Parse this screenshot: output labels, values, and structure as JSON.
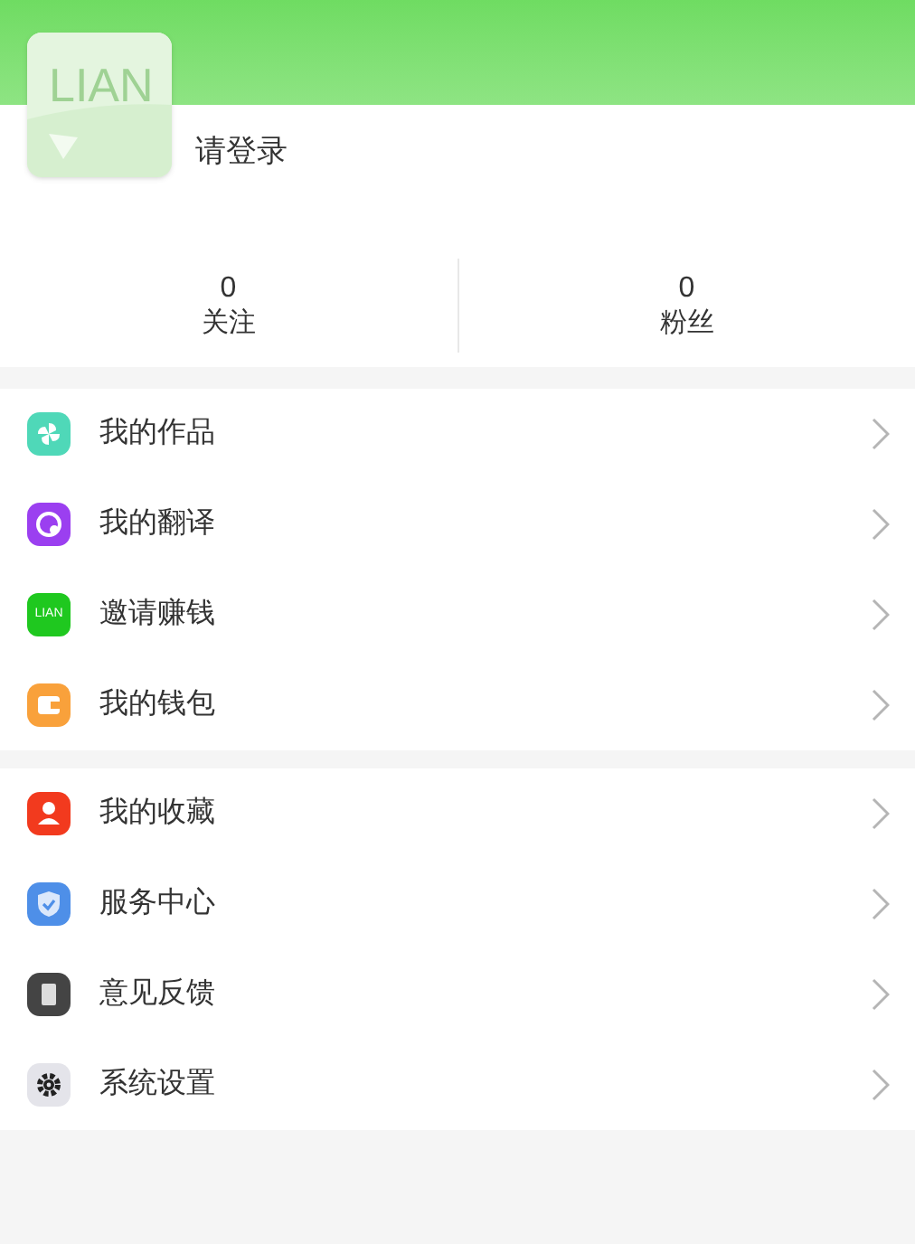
{
  "profile": {
    "avatar_text": "LIAN",
    "name": "请登录"
  },
  "stats": [
    {
      "value": "0",
      "label": "关注"
    },
    {
      "value": "0",
      "label": "粉丝"
    }
  ],
  "menu_groups": [
    [
      {
        "label": "我的作品"
      },
      {
        "label": "我的翻译"
      },
      {
        "icon_text": "LIAN",
        "label": "邀请赚钱"
      },
      {
        "label": "我的钱包"
      }
    ],
    [
      {
        "label": "我的收藏"
      },
      {
        "label": "服务中心"
      },
      {
        "label": "意见反馈"
      },
      {
        "label": "系统设置"
      }
    ]
  ]
}
